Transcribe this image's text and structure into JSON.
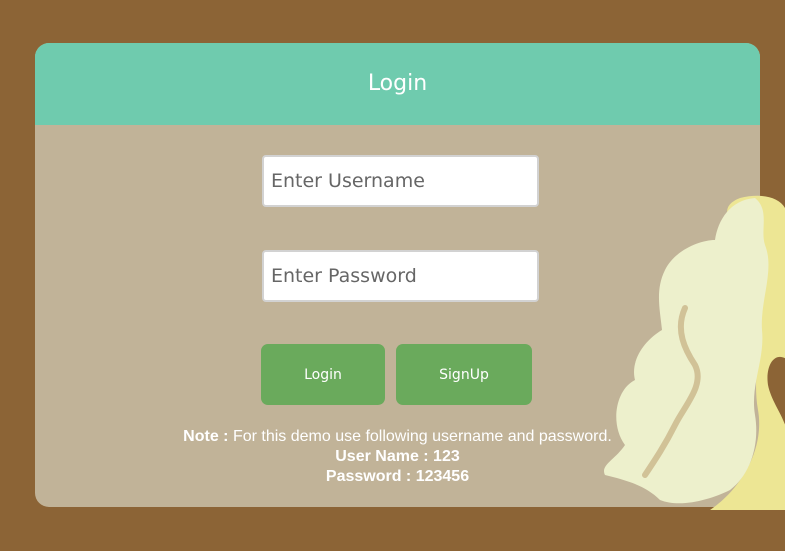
{
  "header": {
    "title": "Login"
  },
  "form": {
    "username_placeholder": "Enter Username",
    "password_placeholder": "Enter Password"
  },
  "buttons": {
    "login_label": "Login",
    "signup_label": "SignUp"
  },
  "note": {
    "label": "Note :",
    "text": " For this demo use following username and password.",
    "username_line": "User Name : 123",
    "password_line": "Password : 123456"
  },
  "colors": {
    "page_background": "#8c6436",
    "card_background": "#c1b398",
    "header_background": "#6fcbae",
    "button_background": "#6aaa5c"
  }
}
